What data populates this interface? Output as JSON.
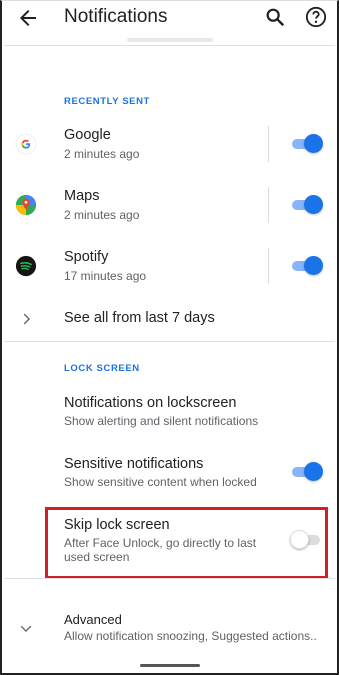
{
  "header": {
    "title": "Notifications"
  },
  "recently_sent": {
    "label": "RECENTLY SENT",
    "apps": [
      {
        "name": "Google",
        "time": "2 minutes ago",
        "icon": "google-icon",
        "enabled": true
      },
      {
        "name": "Maps",
        "time": "2 minutes ago",
        "icon": "maps-icon",
        "enabled": true
      },
      {
        "name": "Spotify",
        "time": "17 minutes ago",
        "icon": "spotify-icon",
        "enabled": true
      }
    ],
    "see_all": "See all from last 7 days"
  },
  "lock_screen": {
    "label": "LOCK SCREEN",
    "notifications_on_lockscreen": {
      "title": "Notifications on lockscreen",
      "subtitle": "Show alerting and silent notifications"
    },
    "sensitive": {
      "title": "Sensitive notifications",
      "subtitle": "Show sensitive content when locked",
      "enabled": true
    },
    "skip_lock": {
      "title": "Skip lock screen",
      "subtitle_line1": "After Face Unlock, go directly to last",
      "subtitle_line2": "used screen",
      "enabled": false
    }
  },
  "advanced": {
    "title": "Advanced",
    "subtitle": "Allow notification snoozing, Suggested actions.."
  },
  "colors": {
    "accent": "#1a73e8",
    "highlight": "#d21f26"
  }
}
